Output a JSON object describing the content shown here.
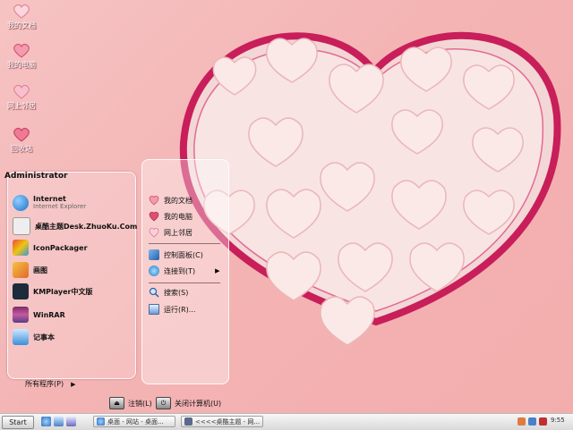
{
  "desktop": {
    "icons": [
      {
        "label": "我的文档",
        "icon": "my-documents-heart-icon"
      },
      {
        "label": "我的电脑",
        "icon": "my-computer-heart-icon"
      },
      {
        "label": "网上邻居",
        "icon": "network-places-heart-icon"
      },
      {
        "label": "回收站",
        "icon": "recycle-bin-heart-icon"
      }
    ]
  },
  "start_menu": {
    "user": "Administrator",
    "programs": [
      {
        "label": "Internet",
        "sublabel": "Internet Explorer",
        "icon": "internet-explorer-icon",
        "color": "#2a7fd8"
      },
      {
        "label": "桌酷主题Desk.ZhuoKu.Com",
        "icon": "zhuoku-theme-icon",
        "color": "#e8e8e8"
      },
      {
        "label": "IconPackager",
        "icon": "iconpackager-icon",
        "color": "#c0392b"
      },
      {
        "label": "画图",
        "icon": "paint-icon",
        "color": "#f0a030"
      },
      {
        "label": "KMPlayer中文版",
        "icon": "kmplayer-icon",
        "color": "#203040"
      },
      {
        "label": "WinRAR",
        "icon": "winrar-icon",
        "color": "#8b2b6a"
      },
      {
        "label": "记事本",
        "icon": "notepad-icon",
        "color": "#4aa0e0"
      }
    ],
    "all_programs": "所有程序(P)",
    "places": [
      {
        "label": "我的文档",
        "icon": "my-documents-icon"
      },
      {
        "label": "我的电脑",
        "icon": "my-computer-icon"
      },
      {
        "label": "网上邻居",
        "icon": "network-places-icon"
      },
      {
        "label": "控制面板(C)",
        "icon": "control-panel-icon"
      },
      {
        "label": "连接到(T)",
        "icon": "connect-to-icon"
      },
      {
        "label": "搜索(S)",
        "icon": "search-icon"
      },
      {
        "label": "运行(R)...",
        "icon": "run-icon"
      }
    ],
    "logoff": "注销(L)",
    "shutdown": "关闭计算机(U)"
  },
  "taskbar": {
    "start": "Start",
    "tasks": [
      {
        "label": "桌面 - 网站 - 桌面..."
      },
      {
        "label": "<<<<桌酷主题 - 网..."
      }
    ],
    "clock": "9:55"
  }
}
